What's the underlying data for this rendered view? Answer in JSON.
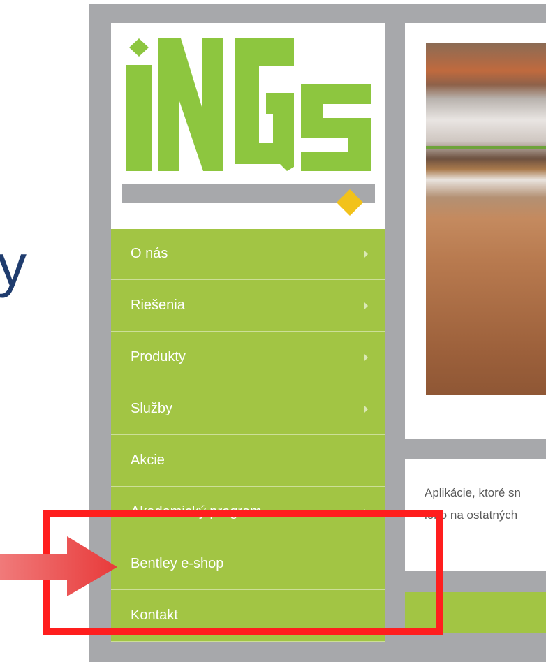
{
  "logo": {
    "text": "iNGs"
  },
  "menu": {
    "items": [
      {
        "label": "O nás",
        "has_submenu": true
      },
      {
        "label": "Riešenia",
        "has_submenu": true
      },
      {
        "label": "Produkty",
        "has_submenu": true
      },
      {
        "label": "Služby",
        "has_submenu": true
      },
      {
        "label": "Akcie",
        "has_submenu": false
      },
      {
        "label": "Akademický program",
        "has_submenu": true
      },
      {
        "label": "Bentley e-shop",
        "has_submenu": false
      },
      {
        "label": "Kontakt",
        "has_submenu": false
      }
    ]
  },
  "content": {
    "text_line_1": "Aplikácie, ktoré sn",
    "text_line_2": "lebo na ostatných"
  },
  "left_fragment": "y",
  "colors": {
    "menu_green": "#a2c544",
    "logo_green": "#8dc63f",
    "logo_gray": "#a7a8ab",
    "logo_yellow": "#f2c21b",
    "frame_gray": "#a7a8ab",
    "highlight_red": "#ff1e1e",
    "arrow_red": "#ee4a4a"
  }
}
